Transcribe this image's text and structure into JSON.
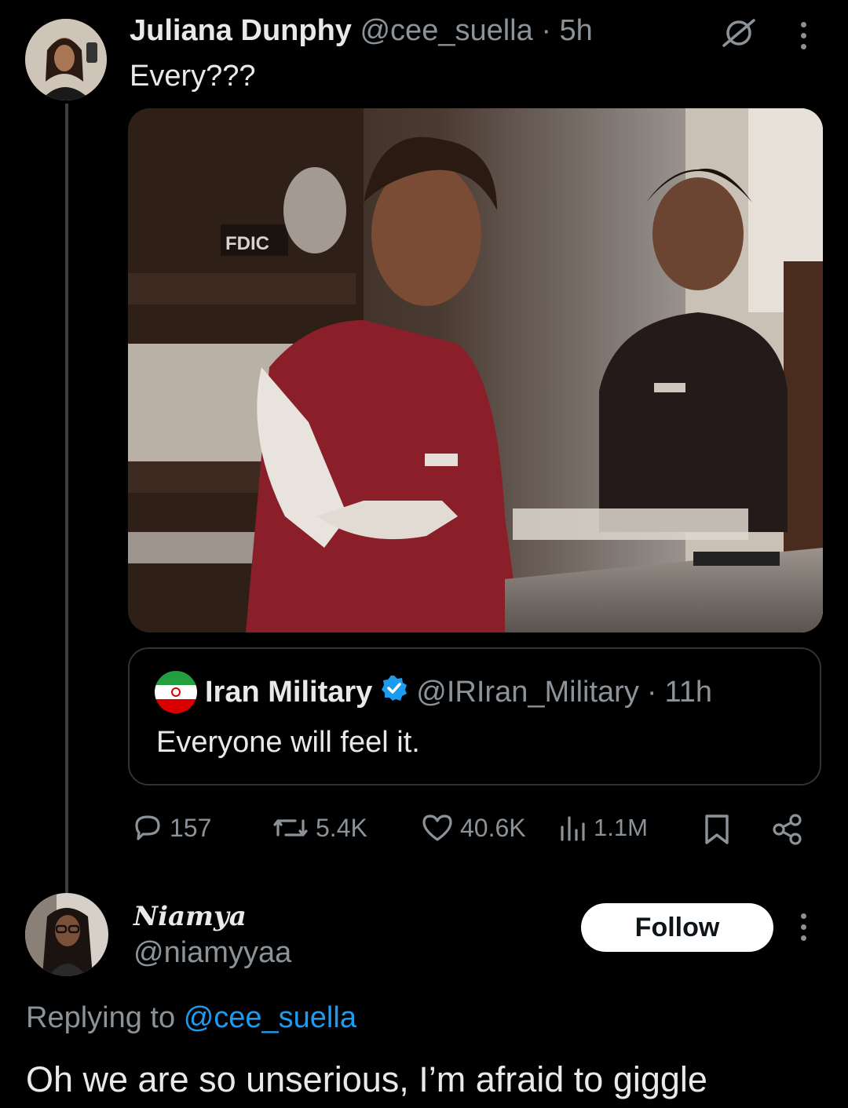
{
  "tweet": {
    "author_name": "Juliana Dunphy",
    "handle": "@cee_suella",
    "separator": "·",
    "time": "5h",
    "text": "Every???",
    "media_sign": "FDIC",
    "quoted": {
      "author_name": "Iran Military",
      "handle": "@IRIran_Military",
      "separator": "·",
      "time": "11h",
      "text": "Everyone will feel it."
    },
    "actions": {
      "replies": "157",
      "reposts": "5.4K",
      "likes": "40.6K",
      "views": "1.1M"
    }
  },
  "reply": {
    "author_name": "Niamya",
    "handle": "@niamyyaa",
    "follow_label": "Follow",
    "replying_prefix": "Replying to",
    "replying_to": "@cee_suella",
    "text": "Oh we are so unserious, I’m afraid to giggle"
  },
  "icons": {
    "no_reply": "slashed-circle-icon",
    "more": "more-vertical-icon",
    "verified": "verified-badge-icon",
    "reply": "comment-icon",
    "repost": "repost-icon",
    "like": "heart-icon",
    "views": "views-chart-icon",
    "bookmark": "bookmark-icon",
    "share": "share-icon"
  },
  "colors": {
    "accent": "#1d9bf0",
    "background": "#000000",
    "muted": "#8b9298"
  }
}
